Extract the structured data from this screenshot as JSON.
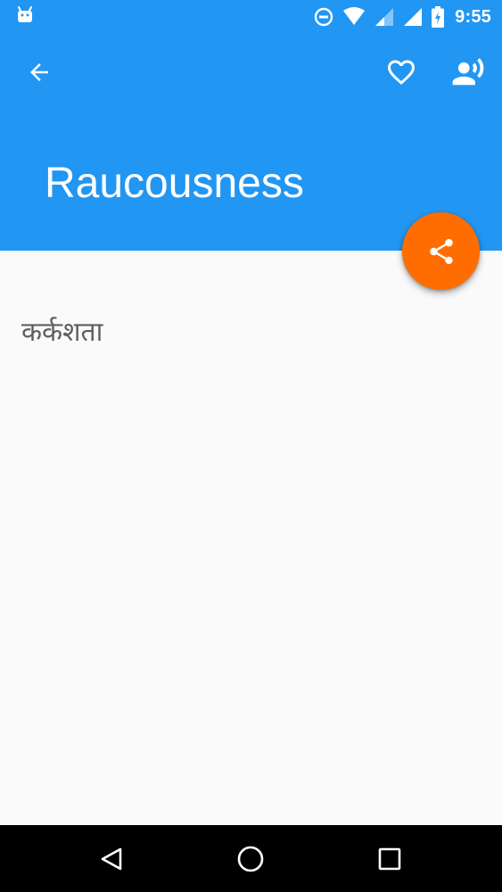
{
  "status_bar": {
    "time": "9:55",
    "icons": [
      "android-notification-icon",
      "do-not-disturb-icon",
      "wifi-icon",
      "signal-icon",
      "signal-icon",
      "battery-charging-icon"
    ]
  },
  "toolbar": {
    "back_icon": "arrow-back-icon",
    "favorite_icon": "heart-outline-icon",
    "speak_icon": "record-voice-icon"
  },
  "word": {
    "headword": "Raucousness",
    "meaning": "कर्कशता"
  },
  "fab": {
    "icon": "share-icon"
  },
  "nav_bar": {
    "icons": [
      "nav-back-icon",
      "nav-home-icon",
      "nav-recents-icon"
    ]
  },
  "colors": {
    "primary": "#2196F3",
    "accent": "#FF6D00",
    "background": "#FAFAFA",
    "meaning_text": "#5F5F5F",
    "nav_bar": "#000000"
  }
}
